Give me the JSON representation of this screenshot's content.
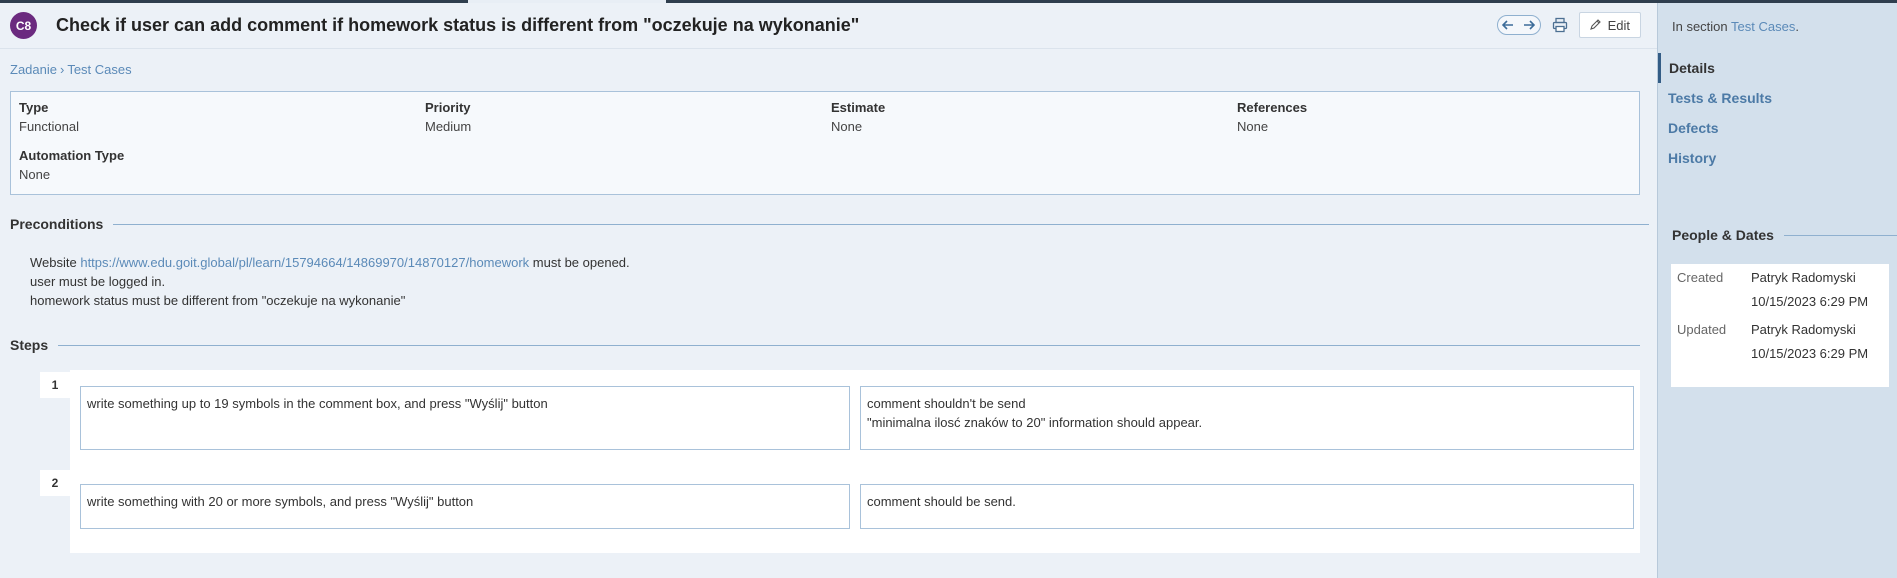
{
  "header": {
    "case_id": "C8",
    "title": "Check if user can add comment if homework status is different from \"oczekuje na wykonanie\"",
    "edit_label": "Edit"
  },
  "breadcrumb": {
    "parent": "Zadanie",
    "separator": "›",
    "current": "Test Cases"
  },
  "fields": {
    "type": {
      "label": "Type",
      "value": "Functional"
    },
    "priority": {
      "label": "Priority",
      "value": "Medium"
    },
    "estimate": {
      "label": "Estimate",
      "value": "None"
    },
    "references": {
      "label": "References",
      "value": "None"
    },
    "automation_type": {
      "label": "Automation Type",
      "value": "None"
    }
  },
  "preconditions": {
    "title": "Preconditions",
    "line1_prefix": "Website ",
    "line1_link": "https://www.edu.goit.global/pl/learn/15794664/14869970/14870127/homework",
    "line1_suffix": " must be opened.",
    "line2": "user must be logged in.",
    "line3": "homework status must be different from \"oczekuje na wykonanie\""
  },
  "steps": {
    "title": "Steps",
    "items": [
      {
        "number": "1",
        "content": "write something up to 19 symbols in the comment box, and press \"Wyślij\" button",
        "expected_line1": "comment shouldn't be send",
        "expected_line2": "\"minimalna ilosć znaków to 20\" information should appear."
      },
      {
        "number": "2",
        "content": "write something with 20 or more symbols, and press \"Wyślij\" button",
        "expected_line1": "comment should be send.",
        "expected_line2": ""
      }
    ]
  },
  "sidebar": {
    "in_section_prefix": "In section ",
    "in_section_link": "Test Cases",
    "in_section_suffix": ".",
    "nav": [
      {
        "label": "Details",
        "active": true
      },
      {
        "label": "Tests & Results",
        "active": false
      },
      {
        "label": "Defects",
        "active": false
      },
      {
        "label": "History",
        "active": false
      }
    ],
    "people_title": "People & Dates",
    "created_label": "Created",
    "created_by": "Patryk Radomyski",
    "created_at": "10/15/2023 6:29 PM",
    "updated_label": "Updated",
    "updated_by": "Patryk Radomyski",
    "updated_at": "10/15/2023 6:29 PM"
  },
  "colors": {
    "badge": "#6b2a7f",
    "link": "#5b8ab8",
    "sidebar_bg": "#d3e0ec",
    "main_bg": "#ecf1f7"
  },
  "icons": {
    "prev": "arrow-left-icon",
    "next": "arrow-right-icon",
    "print": "printer-icon",
    "edit": "pencil-icon"
  }
}
